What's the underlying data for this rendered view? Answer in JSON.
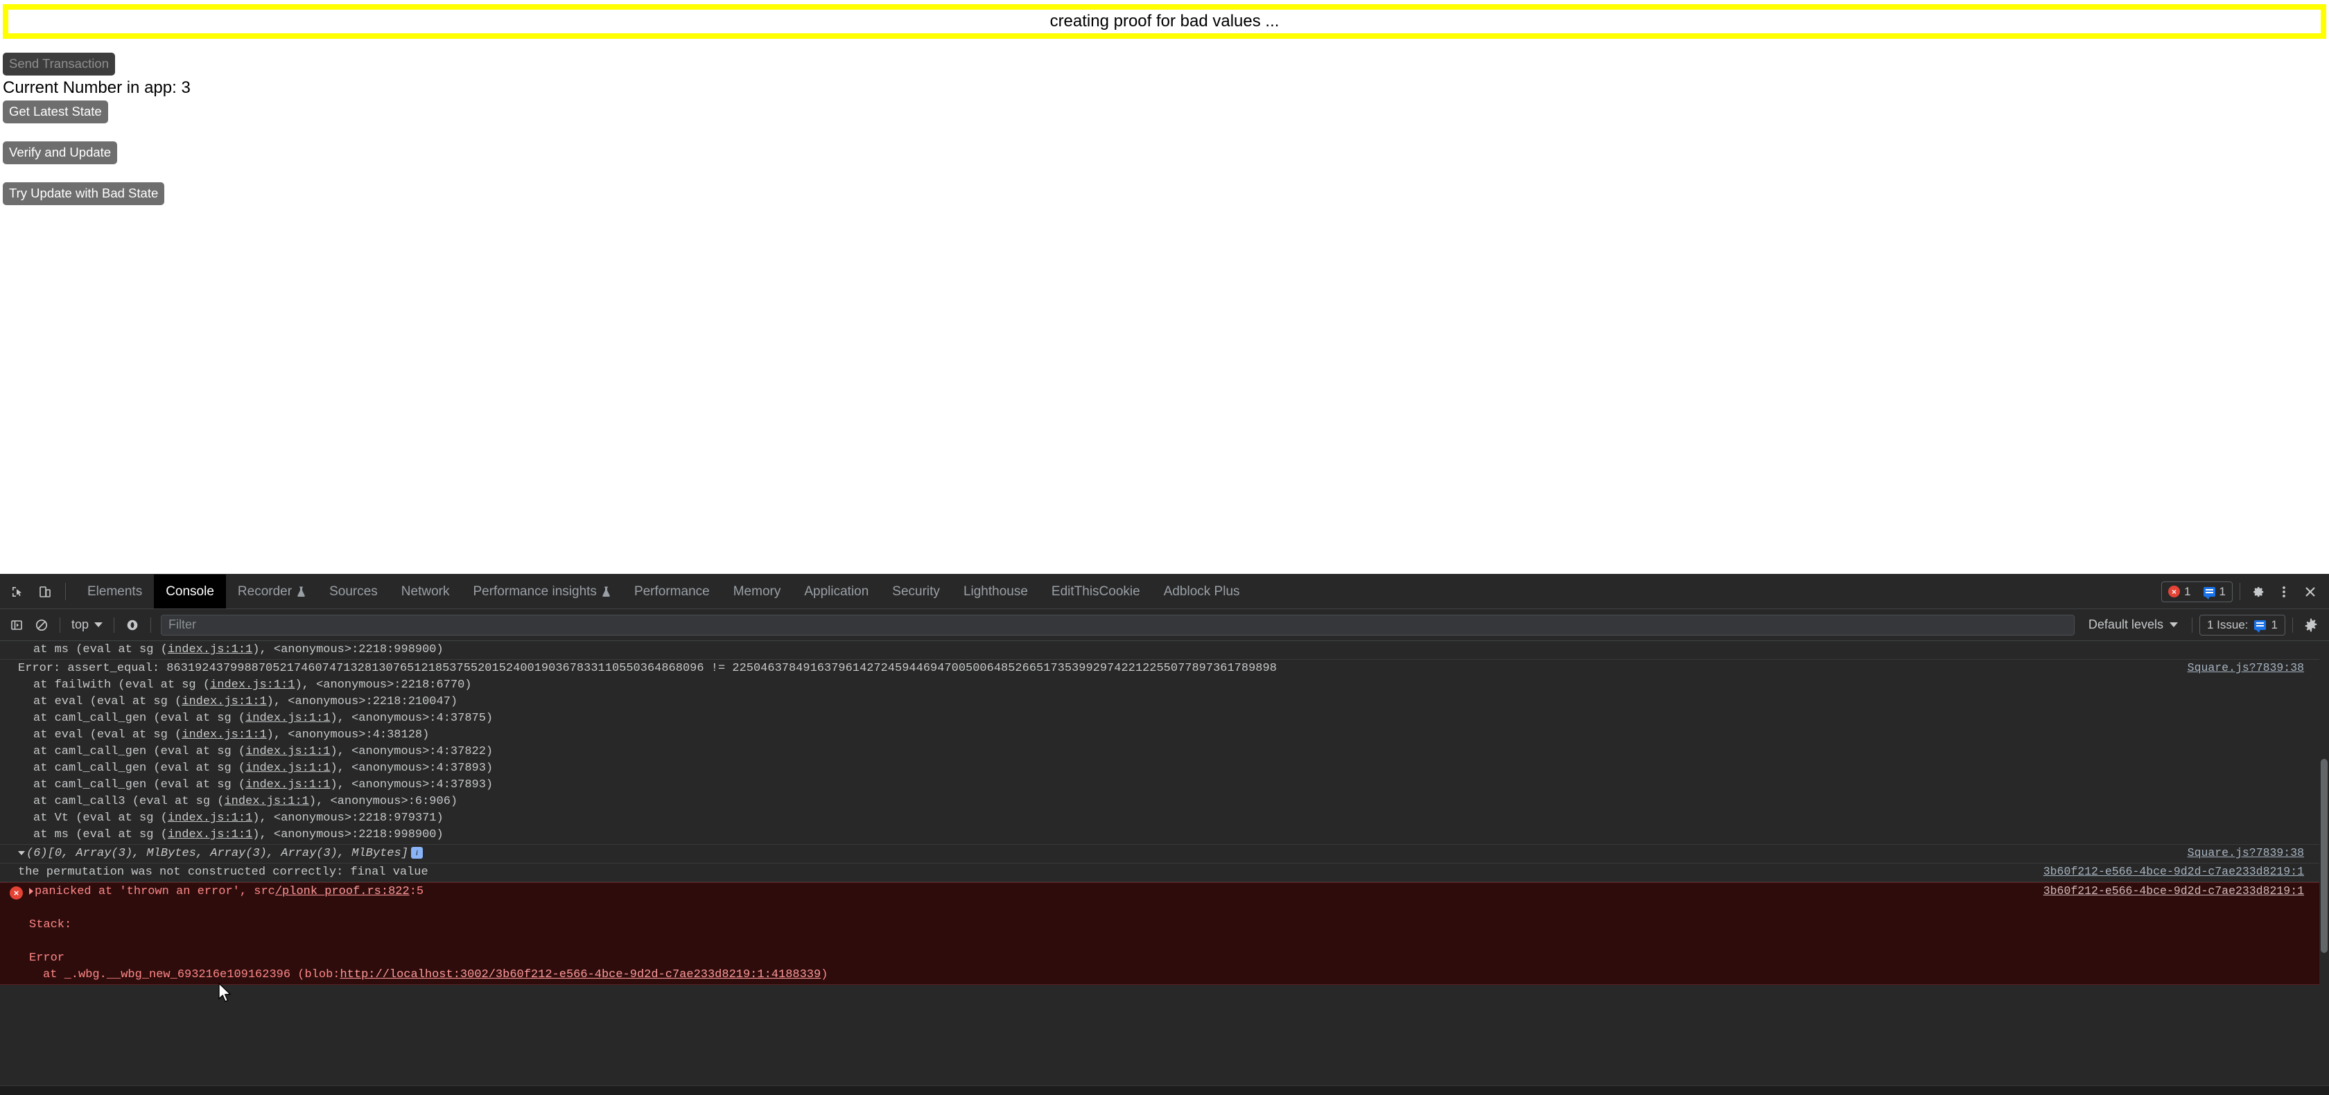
{
  "page": {
    "banner_text": "creating proof for bad values ...",
    "banner_border_color": "#ffff00",
    "buttons": [
      {
        "label": "Send Transaction",
        "disabled": true
      },
      {
        "label": "Get Latest State",
        "disabled": false
      },
      {
        "label": "Verify and Update",
        "disabled": false
      },
      {
        "label": "Try Update with Bad State",
        "disabled": false
      }
    ],
    "status_text": "Current Number in app: 3"
  },
  "devtools": {
    "tabs": [
      {
        "label": "Elements",
        "active": false,
        "beaker": false
      },
      {
        "label": "Console",
        "active": true,
        "beaker": false
      },
      {
        "label": "Recorder",
        "active": false,
        "beaker": true
      },
      {
        "label": "Sources",
        "active": false,
        "beaker": false
      },
      {
        "label": "Network",
        "active": false,
        "beaker": false
      },
      {
        "label": "Performance insights",
        "active": false,
        "beaker": true
      },
      {
        "label": "Performance",
        "active": false,
        "beaker": false
      },
      {
        "label": "Memory",
        "active": false,
        "beaker": false
      },
      {
        "label": "Application",
        "active": false,
        "beaker": false
      },
      {
        "label": "Security",
        "active": false,
        "beaker": false
      },
      {
        "label": "Lighthouse",
        "active": false,
        "beaker": false
      },
      {
        "label": "EditThisCookie",
        "active": false,
        "beaker": false
      },
      {
        "label": "Adblock Plus",
        "active": false,
        "beaker": false
      }
    ],
    "error_badge_count": "1",
    "message_badge_count": "1",
    "icons": {
      "inspect": "inspect-element-icon",
      "device": "device-toolbar-icon",
      "settings": "gear-icon",
      "more": "more-options-icon",
      "close": "close-icon",
      "sidebar": "console-sidebar-icon",
      "clear": "clear-console-icon",
      "eye": "live-expression-icon"
    },
    "filterbar": {
      "context": "top",
      "filter_placeholder": "Filter",
      "filter_value": "",
      "levels": "Default levels",
      "issues_label": "1 Issue:",
      "issues_count": "1"
    },
    "console_rows": [
      {
        "type": "trace",
        "indent": true,
        "text": "at ms (eval at sg (",
        "link": "index.js:1:1",
        "text_after": "), <anonymous>:2218:998900)",
        "source": ""
      },
      {
        "type": "error-text",
        "indent": false,
        "text": "Error: assert_equal: 8631924379988705217460747132813076512185375520152400190367833110550364868096 != 22504637849163796142724594469470050064852665173539929742212255077897361789898",
        "source": "Square.js?7839:38"
      },
      {
        "type": "trace",
        "indent": true,
        "text": "at failwith (eval at sg (",
        "link": "index.js:1:1",
        "text_after": "), <anonymous>:2218:6770)",
        "source": ""
      },
      {
        "type": "trace",
        "indent": true,
        "text": "at eval (eval at sg (",
        "link": "index.js:1:1",
        "text_after": "), <anonymous>:2218:210047)",
        "source": ""
      },
      {
        "type": "trace",
        "indent": true,
        "text": "at caml_call_gen (eval at sg (",
        "link": "index.js:1:1",
        "text_after": "), <anonymous>:4:37875)",
        "source": ""
      },
      {
        "type": "trace",
        "indent": true,
        "text": "at eval (eval at sg (",
        "link": "index.js:1:1",
        "text_after": "), <anonymous>:4:38128)",
        "source": ""
      },
      {
        "type": "trace",
        "indent": true,
        "text": "at caml_call_gen (eval at sg (",
        "link": "index.js:1:1",
        "text_after": "), <anonymous>:4:37822)",
        "source": ""
      },
      {
        "type": "trace",
        "indent": true,
        "text": "at caml_call_gen (eval at sg (",
        "link": "index.js:1:1",
        "text_after": "), <anonymous>:4:37893)",
        "source": ""
      },
      {
        "type": "trace",
        "indent": true,
        "text": "at caml_call_gen (eval at sg (",
        "link": "index.js:1:1",
        "text_after": "), <anonymous>:4:37893)",
        "source": ""
      },
      {
        "type": "trace",
        "indent": true,
        "text": "at caml_call3 (eval at sg (",
        "link": "index.js:1:1",
        "text_after": "), <anonymous>:6:906)",
        "source": ""
      },
      {
        "type": "trace",
        "indent": true,
        "text": "at Vt (eval at sg (",
        "link": "index.js:1:1",
        "text_after": "), <anonymous>:2218:979371)",
        "source": ""
      },
      {
        "type": "trace",
        "indent": true,
        "text": "at ms (eval at sg (",
        "link": "index.js:1:1",
        "text_after": "), <anonymous>:2218:998900)",
        "source": ""
      }
    ],
    "array_row": {
      "count": "(6)",
      "preview_open": "[",
      "first_value": "0",
      "rest": ", Array(3), MlBytes, Array(3), Array(3), MlBytes]",
      "info_badge": "i",
      "source": "Square.js?7839:38"
    },
    "permutation_row": {
      "text": "the permutation was not constructed correctly: final value",
      "source": "3b60f212-e566-4bce-9d2d-c7ae233d8219:1"
    },
    "panic_row": {
      "text_before": "panicked at 'thrown an error', src",
      "link": "/plonk_proof.rs:822",
      "text_after": ":5",
      "source": "3b60f212-e566-4bce-9d2d-c7ae233d8219:1"
    },
    "stack_rows": [
      {
        "text": "Stack:",
        "indent": false
      },
      {
        "text": "",
        "indent": false
      },
      {
        "text": "Error",
        "indent": false
      }
    ],
    "wbg_row": {
      "text_before": "at _.wbg.__wbg_new_693216e109162396 (blob:",
      "link": "http://localhost:3002/3b60f212-e566-4bce-9d2d-c7ae233d8219:1:4188339",
      "text_after": ")"
    }
  }
}
